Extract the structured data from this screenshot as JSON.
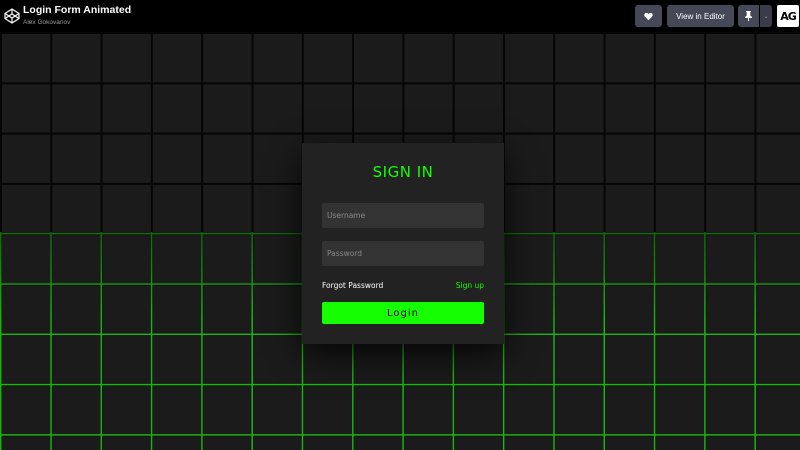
{
  "header": {
    "pen_title": "Login Form Animated",
    "author": "Alex Gokovanov",
    "logo_icon": "codepen-logo-icon",
    "heart_icon": "heart-icon",
    "view_editor_label": "View in Editor",
    "pin_icon": "pin-icon",
    "caret_label": "⌄",
    "avatar_text": "AG"
  },
  "login": {
    "title": "SIGN IN",
    "username_placeholder": "Username",
    "password_placeholder": "Password",
    "forgot_label": "Forgot Password",
    "signup_label": "Sign up",
    "login_label": "Login"
  },
  "colors": {
    "accent": "#16ff00",
    "grid_glow": "#22d414",
    "card_bg": "#222222",
    "field_bg": "#333333",
    "topbar_bg": "#000000",
    "button_bg": "#444857"
  }
}
